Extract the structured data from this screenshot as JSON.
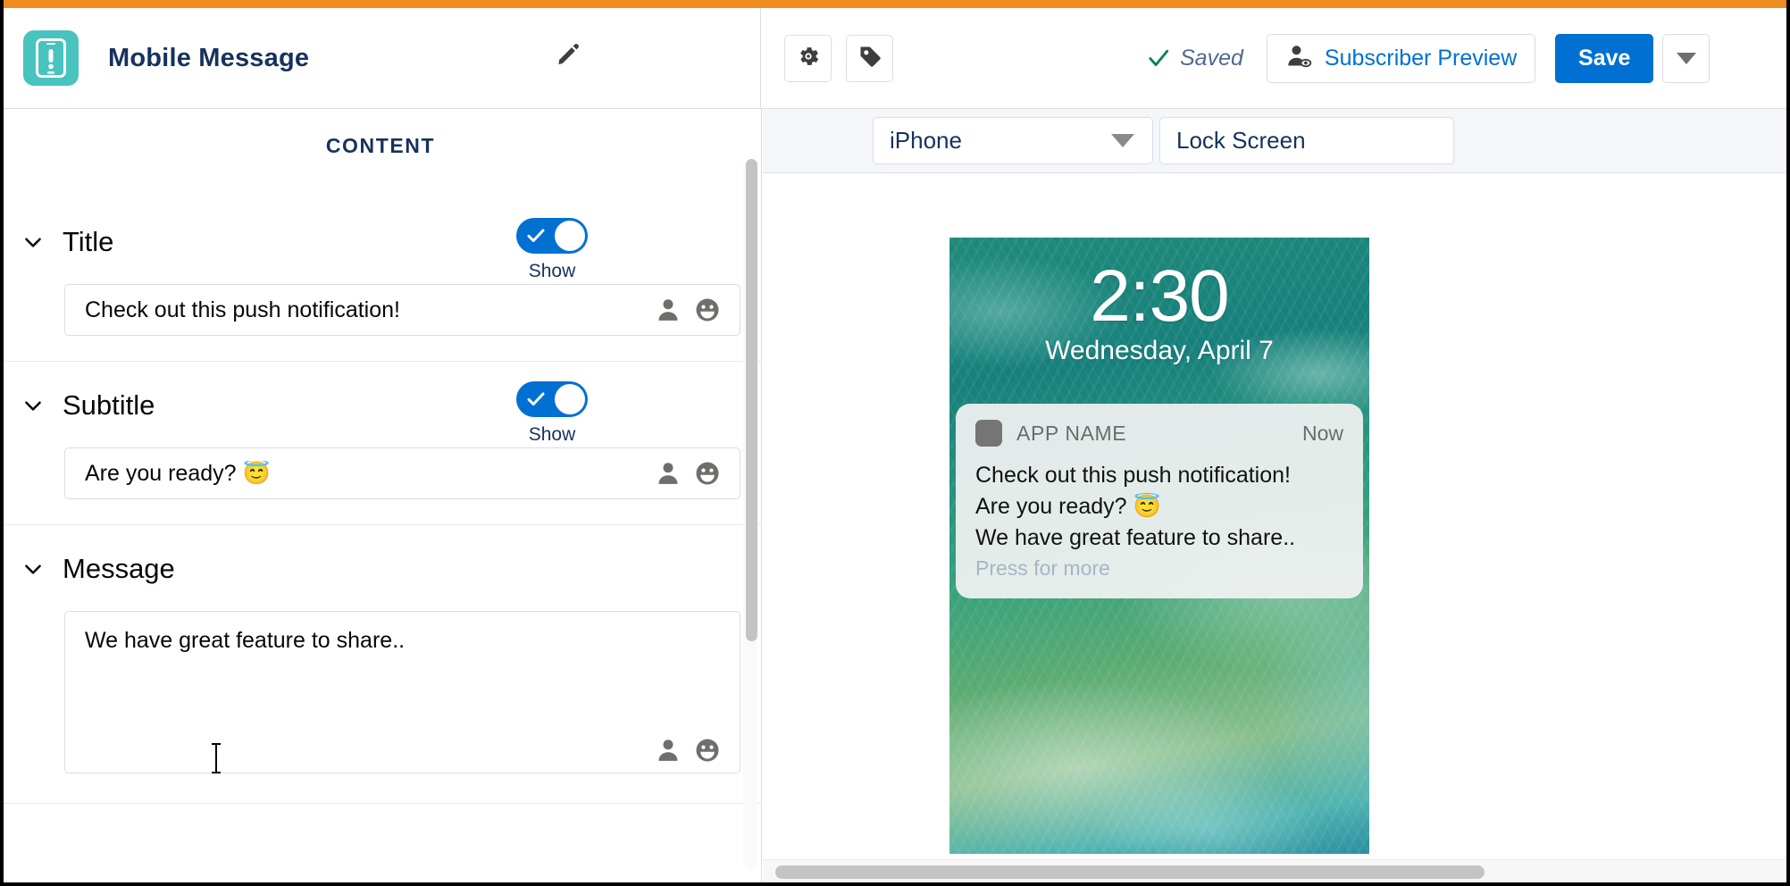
{
  "theme": {
    "accent_orange": "#ef8b1f",
    "brand_blue": "#0070d2",
    "app_icon_teal": "#49c3bd",
    "success_green": "#04844b"
  },
  "header": {
    "app_icon_name": "mobile-message-icon",
    "title": "Mobile Message",
    "edit_name_icon": "pencil-icon",
    "settings_icon": "gear-icon",
    "tag_icon": "tag-icon",
    "saved_status": "Saved",
    "saved_check_icon": "check-icon",
    "subscriber_preview_label": "Subscriber Preview",
    "subscriber_preview_icon": "user-preview-icon",
    "save_label": "Save",
    "save_caret_icon": "caret-down-icon"
  },
  "left_panel": {
    "heading": "CONTENT",
    "sections": [
      {
        "id": "title",
        "chevron_icon": "chevron-down-icon",
        "label": "Title",
        "has_toggle": true,
        "toggle_on": true,
        "toggle_label": "Show",
        "field_type": "input",
        "value": "Check out this push notification!",
        "personalize_icon": "person-icon",
        "emoji_icon": "emoji-smiley-icon"
      },
      {
        "id": "subtitle",
        "chevron_icon": "chevron-down-icon",
        "label": "Subtitle",
        "has_toggle": true,
        "toggle_on": true,
        "toggle_label": "Show",
        "field_type": "input",
        "value": "Are you ready? 😇",
        "personalize_icon": "person-icon",
        "emoji_icon": "emoji-smiley-icon"
      },
      {
        "id": "message",
        "chevron_icon": "chevron-down-icon",
        "label": "Message",
        "has_toggle": false,
        "field_type": "textarea",
        "value": "We have great feature to share..",
        "personalize_icon": "person-icon",
        "emoji_icon": "emoji-smiley-icon"
      }
    ]
  },
  "right_panel": {
    "device_select": {
      "value": "iPhone",
      "caret_icon": "caret-down-icon"
    },
    "screen_select": {
      "value": "Lock Screen"
    },
    "preview": {
      "lock_time": "2:30",
      "lock_date": "Wednesday, April 7",
      "notification": {
        "app_icon_name": "app-placeholder-icon",
        "app_name": "APP NAME",
        "time": "Now",
        "lines": [
          "Check out this push notification!",
          "Are you ready? 😇",
          "We have great feature to share.."
        ],
        "press_for_more": "Press for more"
      }
    }
  }
}
